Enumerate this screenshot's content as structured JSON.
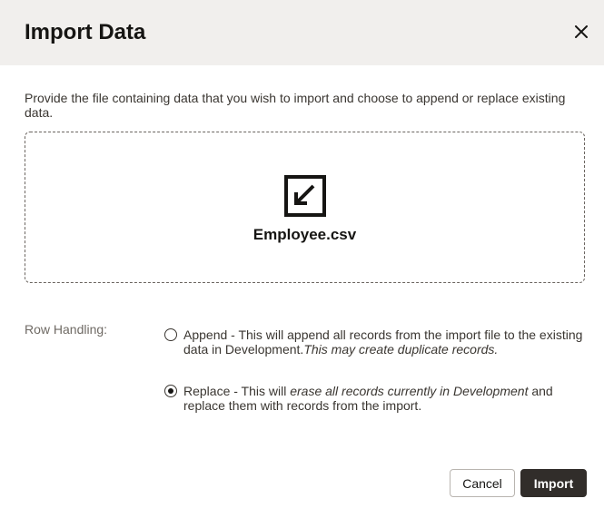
{
  "dialog": {
    "title": "Import Data",
    "close_icon": "close-icon"
  },
  "description": "Provide the file containing data that you wish to import and choose to append or replace existing data.",
  "dropzone": {
    "icon": "import-arrow-icon",
    "filename": "Employee.csv"
  },
  "row_handling": {
    "label": "Row Handling:",
    "options": [
      {
        "value": "append",
        "checked": false,
        "text_plain": "Append - This will append all records from the import file to the existing data in Development.",
        "text_italic": "This may create duplicate records."
      },
      {
        "value": "replace",
        "checked": true,
        "text_before": "Replace - This will ",
        "text_italic": "erase all records currently in Development",
        "text_after": " and replace them with records from the import."
      }
    ]
  },
  "buttons": {
    "cancel": "Cancel",
    "import": "Import"
  },
  "colors": {
    "header_bg": "#f1efed",
    "primary_button": "#312d2a",
    "text": "#161513"
  }
}
